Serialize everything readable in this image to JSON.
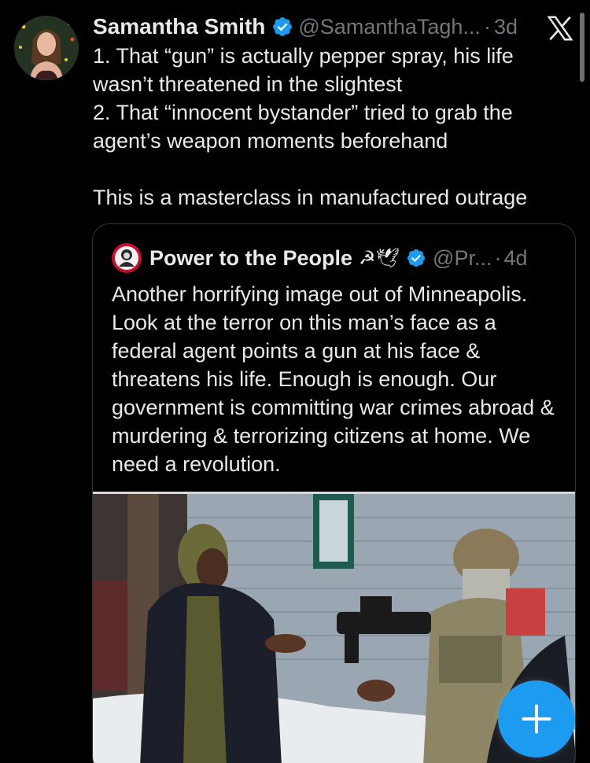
{
  "tweet": {
    "author": {
      "display_name": "Samantha Smith",
      "handle": "@SamanthaTagh...",
      "avatar_icon": "profile-photo",
      "verified": true
    },
    "separator": "·",
    "time": "3d",
    "text": "1. That “gun” is actually pepper spray, his life wasn’t threatened in the slightest\n2. That “innocent bystander” tried to grab the agent’s weapon moments beforehand\n\nThis is a masterclass in manufactured outrage"
  },
  "quoted_tweet": {
    "author": {
      "display_name": "Power to the People",
      "emoji": "☭🕊",
      "handle": "@Pr...",
      "avatar_icon": "marx-portrait-icon",
      "verified": true
    },
    "separator": "·",
    "time": "4d",
    "text": "Another horrifying image out of Minneapolis. Look at the terror on this man’s face as a federal agent points a gun at his face & threatens his life. Enough is enough. Our government is committing war crimes abroad & murdering & terrorizing citizens at home. We need a revolution.",
    "media": {
      "type": "photo",
      "description_icon": "photo-agent-and-man"
    }
  },
  "ui": {
    "close_icon": "x-logo-icon",
    "compose_icon": "plus-icon",
    "colors": {
      "background": "#000000",
      "text": "#e7e9ea",
      "secondary": "#71767b",
      "accent": "#1d9bf0",
      "border": "#2f3336"
    }
  }
}
